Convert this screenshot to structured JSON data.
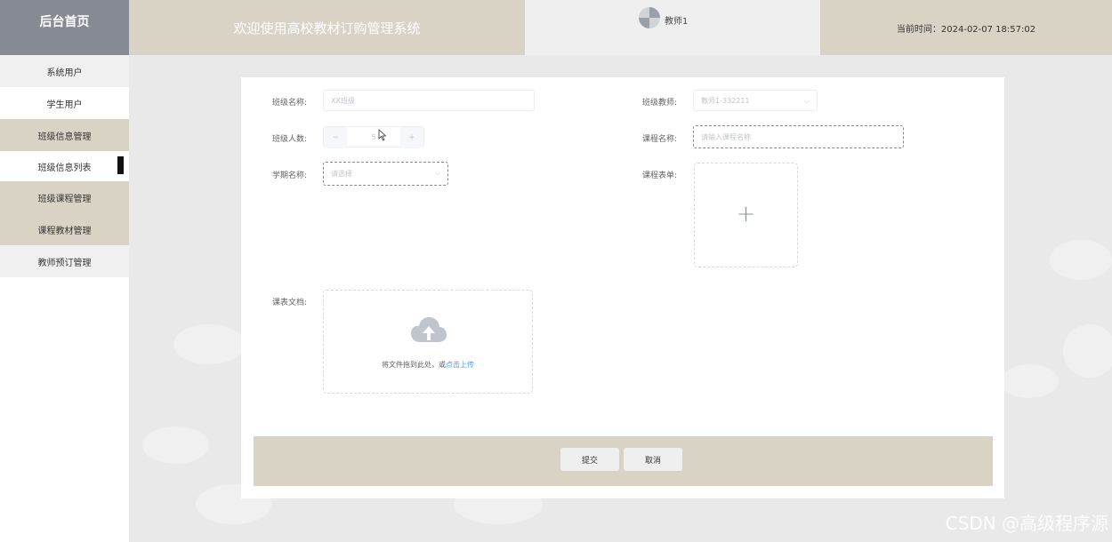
{
  "header": {
    "brand": "后台首页",
    "system_title": "欢迎使用高校教材订购管理系统",
    "user_name": "教师1",
    "current_time": "当前时间：2024-02-07 18:57:02"
  },
  "sidebar": {
    "items": [
      {
        "label": "系统用户"
      },
      {
        "label": "学生用户"
      },
      {
        "label": "班级信息管理"
      },
      {
        "label": "班级信息列表"
      },
      {
        "label": "班级课程管理"
      },
      {
        "label": "课程教材管理"
      },
      {
        "label": "教师预订管理"
      }
    ],
    "active_item": "班级信息列表"
  },
  "form": {
    "class_name": {
      "label": "班级名称:",
      "placeholder": "XX班级"
    },
    "class_teacher": {
      "label": "班级教师:",
      "placeholder": "教师1-332211"
    },
    "class_size": {
      "label": "班级人数:",
      "value": "5",
      "minus": "−",
      "plus": "+"
    },
    "course_name": {
      "label": "课程名称:",
      "placeholder": "请输入课程名称"
    },
    "term_name": {
      "label": "学期名称:",
      "placeholder": "请选择"
    },
    "course_form": {
      "label": "课程表单:",
      "plus": "+"
    },
    "course_doc": {
      "label": "课表文档:",
      "drag_text": "将文件拖到此处，或",
      "click_text": "点击上传"
    }
  },
  "actions": {
    "submit": "提交",
    "cancel": "取消"
  },
  "watermark": "CSDN @高级程序源",
  "colors": {
    "brand_bg": "#868b93",
    "header_tan": "#d8d3c5",
    "link_blue": "#409eff"
  }
}
